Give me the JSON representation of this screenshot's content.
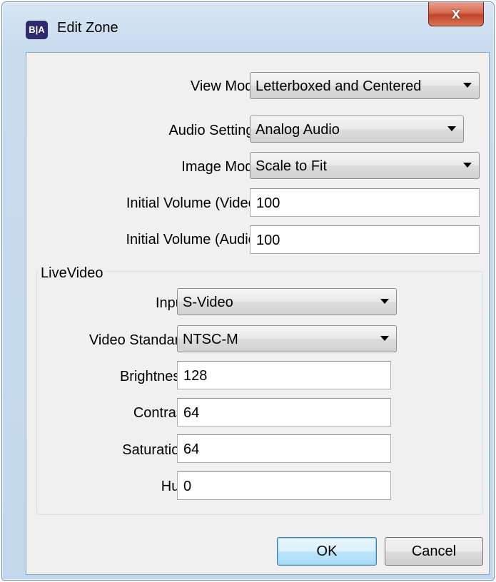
{
  "window": {
    "title": "Edit Zone",
    "app_icon_text": "B|A",
    "close_symbol": "x"
  },
  "form": {
    "view_mode": {
      "label": "View Mode:",
      "value": "Letterboxed and Centered"
    },
    "audio_settings": {
      "label": "Audio Settings:",
      "value": "Analog Audio"
    },
    "image_mode": {
      "label": "Image Mode:",
      "value": "Scale to Fit"
    },
    "initial_volume_video": {
      "label": "Initial Volume (Video):",
      "value": "100"
    },
    "initial_volume_audio": {
      "label": "Initial Volume (Audio):",
      "value": "100"
    }
  },
  "live_video": {
    "title": "LiveVideo",
    "input": {
      "label": "Input:",
      "value": "S-Video"
    },
    "video_standard": {
      "label": "Video Standard:",
      "value": "NTSC-M"
    },
    "brightness": {
      "label": "Brightness:",
      "value": "128"
    },
    "contrast": {
      "label": "Contrast:",
      "value": "64"
    },
    "saturation": {
      "label": "Saturation:",
      "value": "64"
    },
    "hue": {
      "label": "Hue:",
      "value": "0"
    }
  },
  "buttons": {
    "ok": "OK",
    "cancel": "Cancel"
  },
  "colors": {
    "title_bar": "#c9dcee",
    "close_button": "#c2432a",
    "dialog_background": "#f0f0f0",
    "default_button": "#bee6fd"
  },
  "icons": {
    "app": "brightauthor-logo-icon",
    "close": "close-icon",
    "dropdown": "chevron-down-icon"
  }
}
